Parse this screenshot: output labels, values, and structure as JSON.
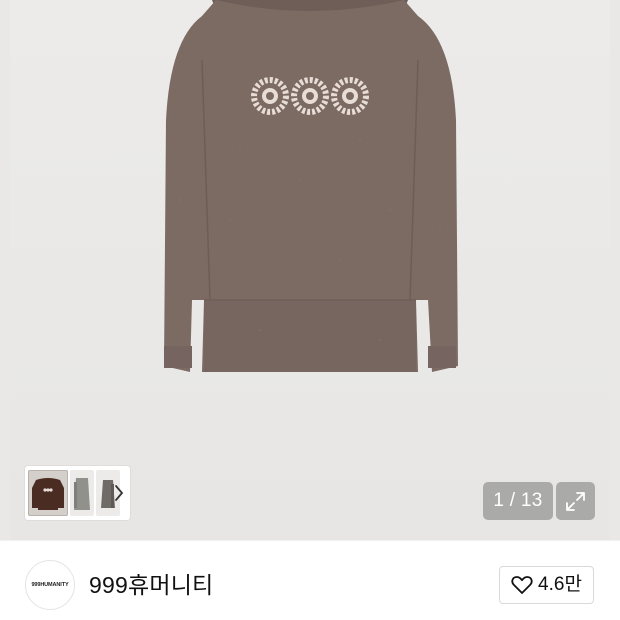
{
  "gallery": {
    "counter": "1 / 13",
    "thumbnails": [
      "thumb-1",
      "thumb-2",
      "thumb-3"
    ],
    "icons": {
      "next": "chevron-right-icon",
      "expand": "expand-icon"
    }
  },
  "product": {
    "image_alt": "sweater",
    "motif_count": 3
  },
  "brand": {
    "logo_text": "999HUMANITY",
    "name": "999휴머니티"
  },
  "like": {
    "icon": "heart-icon",
    "count": "4.6만"
  },
  "colors": {
    "sweater": "#7c6b63",
    "motif": "#e8dcd6",
    "overlay": "#8c8c8c"
  }
}
